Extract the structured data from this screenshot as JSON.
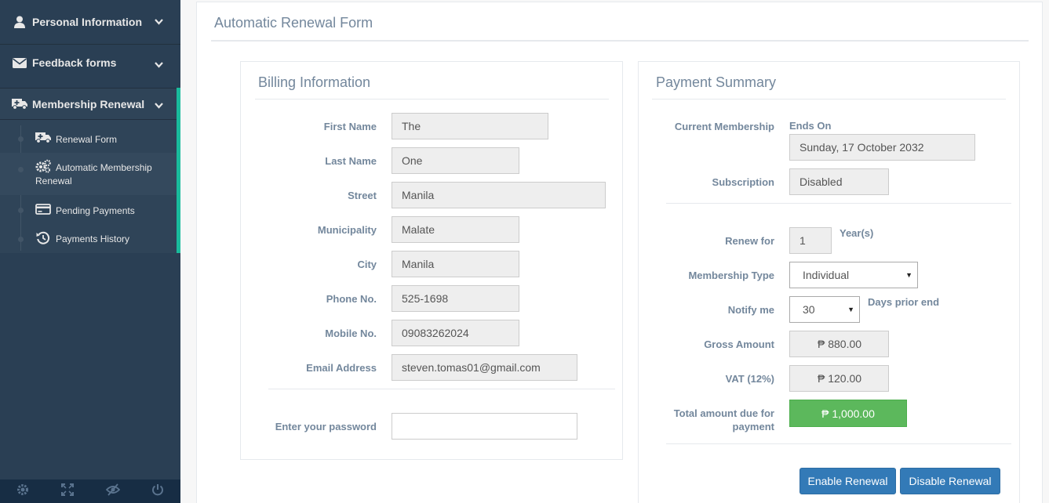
{
  "sidebar": {
    "menu": [
      {
        "label": "Personal Information",
        "icon": "user-icon"
      },
      {
        "label": "Feedback forms",
        "icon": "envelope-icon"
      },
      {
        "label": "Membership Renewal",
        "icon": "ambulance-icon"
      }
    ],
    "children": [
      {
        "label": "Renewal Form",
        "icon": "ambulance-icon"
      },
      {
        "label": "Automatic Membership Renewal",
        "icon": "gears-icon"
      },
      {
        "label": "Pending Payments",
        "icon": "credit-card-icon"
      },
      {
        "label": "Payments History",
        "icon": "history-icon"
      }
    ],
    "footer_icons": [
      "gear-icon",
      "fullscreen-icon",
      "eye-slash-icon",
      "power-icon"
    ],
    "accent": "#1abb9c"
  },
  "page": {
    "title": "Automatic Renewal Form"
  },
  "billing": {
    "title": "Billing Information",
    "fields": [
      {
        "label": "First Name",
        "value": "The"
      },
      {
        "label": "Last Name",
        "value": "One"
      },
      {
        "label": "Street",
        "value": "Manila"
      },
      {
        "label": "Municipality",
        "value": "Malate"
      },
      {
        "label": "City",
        "value": "Manila"
      },
      {
        "label": "Phone No.",
        "value": "525-1698"
      },
      {
        "label": "Mobile No.",
        "value": "09083262024"
      },
      {
        "label": "Email Address",
        "value": "steven.tomas01@gmail.com"
      }
    ],
    "password": {
      "label": "Enter your password",
      "value": ""
    }
  },
  "payment": {
    "title": "Payment Summary",
    "current_membership": {
      "label": "Current Membership",
      "ends_on_label": "Ends On",
      "ends_on": "Sunday, 17 October 2032"
    },
    "subscription": {
      "label": "Subscription",
      "value": "Disabled"
    },
    "renew_for": {
      "label": "Renew for",
      "value": "1",
      "unit": "Year(s)"
    },
    "membership_type": {
      "label": "Membership Type",
      "value": "Individual"
    },
    "notify": {
      "label": "Notify me",
      "value": "30",
      "unit": "Days prior end"
    },
    "gross": {
      "label": "Gross Amount",
      "value": "₱ 880.00"
    },
    "vat": {
      "label": "VAT (12%)",
      "value": "₱ 120.00"
    },
    "total": {
      "label": "Total amount due for payment",
      "value": "₱ 1,000.00"
    },
    "enable_label": "Enable Renewal",
    "disable_label": "Disable Renewal",
    "colors": {
      "total": "#5cb85c",
      "button": "#337ab7"
    }
  }
}
